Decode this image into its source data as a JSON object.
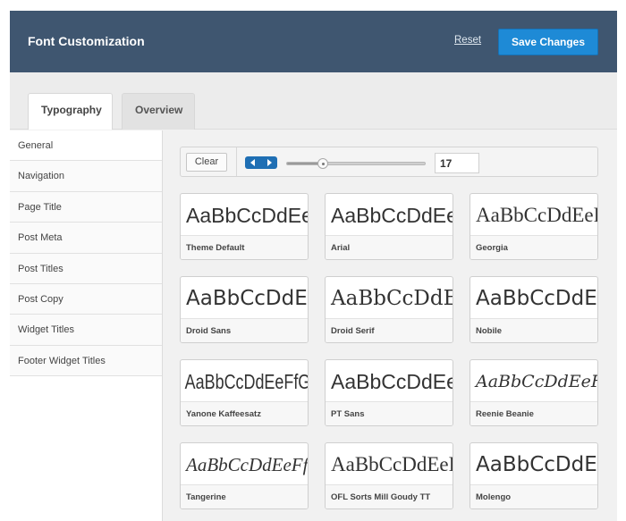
{
  "header": {
    "title": "Font Customization",
    "reset_label": "Reset",
    "save_label": "Save Changes"
  },
  "tabs": [
    {
      "label": "Typography",
      "active": true
    },
    {
      "label": "Overview",
      "active": false
    }
  ],
  "sidebar": {
    "items": [
      {
        "label": "General",
        "active": true
      },
      {
        "label": "Navigation"
      },
      {
        "label": "Page Title"
      },
      {
        "label": "Post Meta"
      },
      {
        "label": "Post Titles"
      },
      {
        "label": "Post Copy"
      },
      {
        "label": "Widget Titles"
      },
      {
        "label": "Footer Widget Titles"
      }
    ]
  },
  "toolbar": {
    "clear_label": "Clear",
    "prev_icon": "triangle-left-icon",
    "next_icon": "triangle-right-icon",
    "slider_fraction": 0.26,
    "size_value": "17"
  },
  "fonts": [
    {
      "sample": "AaBbCcDdEeFfGg",
      "name": "Theme Default"
    },
    {
      "sample": "AaBbCcDdEeFfGg",
      "name": "Arial"
    },
    {
      "sample": "AaBbCcDdEeFfGg",
      "name": "Georgia"
    },
    {
      "sample": "AaBbCcDdEeFfGg",
      "name": "Droid Sans"
    },
    {
      "sample": "AaBbCcDdEeFfGg",
      "name": "Droid Serif"
    },
    {
      "sample": "AaBbCcDdEeFfGg",
      "name": "Nobile"
    },
    {
      "sample": "AaBbCcDdEeFfGg",
      "name": "Yanone Kaffeesatz"
    },
    {
      "sample": "AaBbCcDdEeFfGg",
      "name": "PT Sans"
    },
    {
      "sample": "AaBbCcDdEeFfGg",
      "name": "Reenie Beanie"
    },
    {
      "sample": "AaBbCcDdEeFfGg",
      "name": "Tangerine"
    },
    {
      "sample": "AaBbCcDdEeFfGg",
      "name": "OFL Sorts Mill Goudy TT"
    },
    {
      "sample": "AaBbCcDdEeFfGg",
      "name": "Molengo"
    }
  ],
  "colors": {
    "header_bg": "#3f5670",
    "primary_button": "#1e8ad6",
    "arrow_group": "#1f6fb4"
  }
}
